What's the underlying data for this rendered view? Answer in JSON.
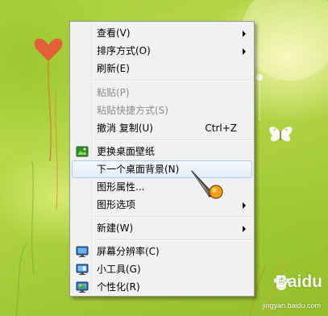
{
  "context_menu": {
    "view": {
      "label": "查看(V)",
      "has_submenu": true
    },
    "sort_by": {
      "label": "排序方式(O)",
      "has_submenu": true
    },
    "refresh": {
      "label": "刷新(E)"
    },
    "paste": {
      "label": "粘贴(P)",
      "enabled": false
    },
    "paste_shortcut": {
      "label": "粘贴快捷方式(S)",
      "enabled": false
    },
    "undo_copy": {
      "label": "撤消 复制(U)",
      "shortcut": "Ctrl+Z"
    },
    "change_wallpaper": {
      "label": "更换桌面壁纸",
      "icon": "wallpaper-icon"
    },
    "next_background": {
      "label": "下一个桌面背景(N)",
      "highlighted": true
    },
    "graphics_properties": {
      "label": "图形属性..."
    },
    "graphics_options": {
      "label": "图形选项",
      "has_submenu": true
    },
    "new": {
      "label": "新建(W)",
      "has_submenu": true
    },
    "screen_resolution": {
      "label": "屏幕分辨率(C)",
      "icon": "monitor-icon"
    },
    "gadgets": {
      "label": "小工具(G)",
      "icon": "gadgets-icon"
    },
    "personalize": {
      "label": "个性化(R)",
      "icon": "personalize-icon"
    }
  },
  "watermark": {
    "brand": "Baidu",
    "site": "jingyan.baidu.com"
  },
  "colors": {
    "menu_background": "#f1f1f1",
    "menu_border": "#979797",
    "highlight_border": "#aeccf1",
    "disabled_text": "#8d8d8d",
    "wallpaper_green": "#a9cf3b"
  }
}
